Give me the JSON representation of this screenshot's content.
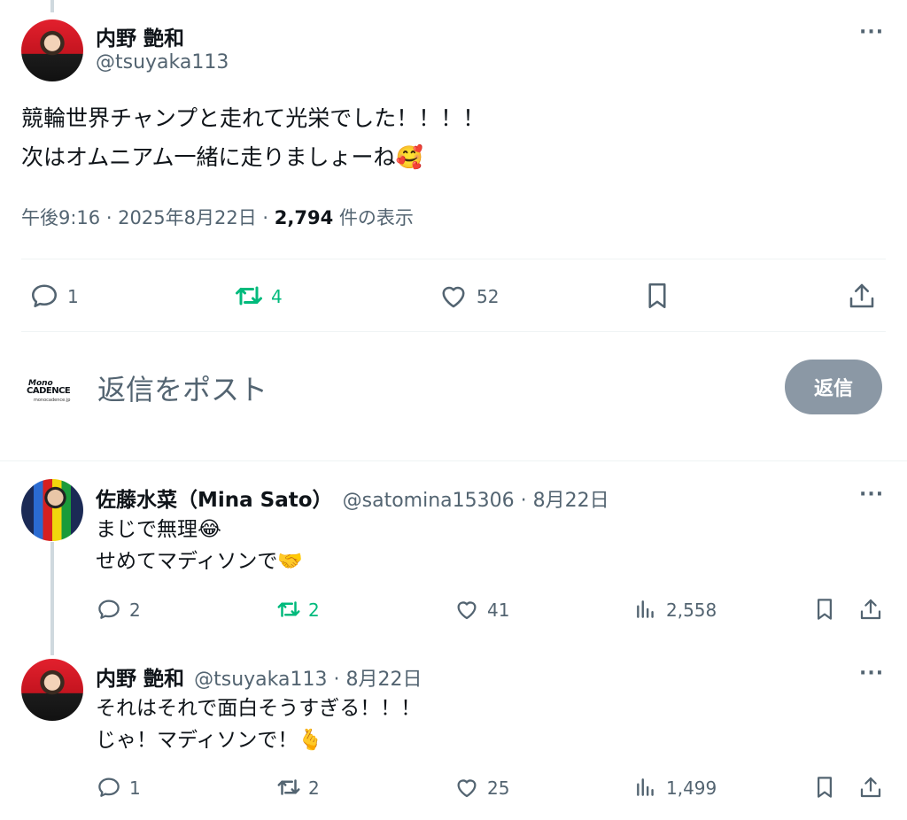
{
  "main_tweet": {
    "name": "内野 艶和",
    "handle": "@tsuyaka113",
    "text_line1": "競輪世界チャンプと走れて光栄でした！！！！",
    "text_line2": "次はオムニアム一緒に走りましょーね🥰",
    "time": "午後9:16 · 2025年8月22日 · ",
    "views": "2,794",
    "views_label": " 件の表示",
    "replies": "1",
    "retweets": "4",
    "likes": "52"
  },
  "composer": {
    "avatar_brand_top": "Mono",
    "avatar_brand_main": "CADENCE",
    "avatar_brand_sub": "monocadence.jp",
    "placeholder": "返信をポスト",
    "reply_button": "返信"
  },
  "reply1": {
    "name": "佐藤水菜（Mina Sato）",
    "handle": "@satomina15306 · 8月22日",
    "text_line1": "まじで無理😂",
    "text_line2": "せめてマディソンで🤝",
    "replies": "2",
    "retweets": "2",
    "likes": "41",
    "views": "2,558"
  },
  "reply2": {
    "name": "内野 艶和",
    "handle": "@tsuyaka113 · 8月22日",
    "text_line1": "それはそれで面白そうすぎる！！！",
    "text_line2": "じゃ！マディソンで！🫰",
    "replies": "1",
    "retweets": "2",
    "likes": "25",
    "views": "1,499"
  },
  "more_glyph": "···",
  "colors": {
    "retweet_green": "#00ba7c",
    "muted": "#536471",
    "button_gray": "#8b98a5"
  }
}
